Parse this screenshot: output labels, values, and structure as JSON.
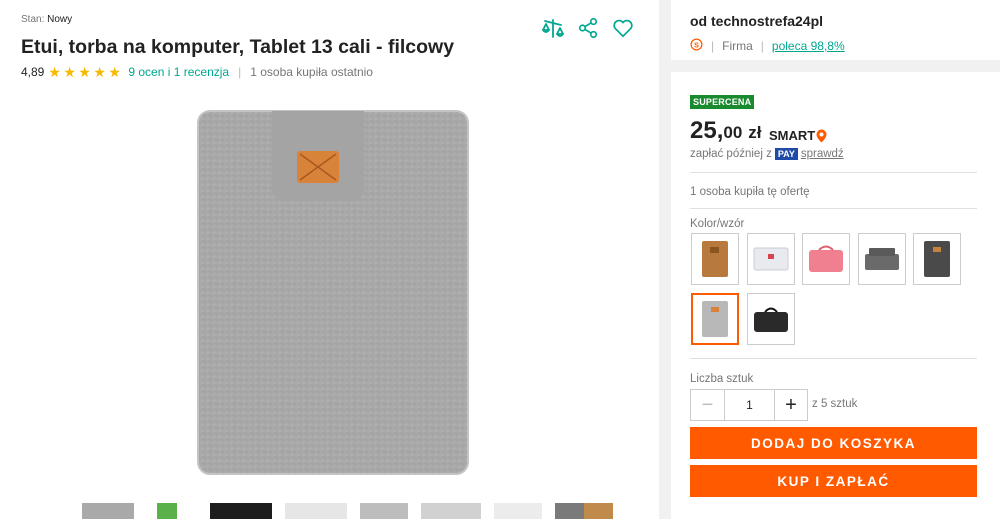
{
  "product": {
    "condition_label": "Stan:",
    "condition_value": "Nowy",
    "title": "Etui, torba na komputer, Tablet 13 cali - filcowy",
    "rating_value": "4,89",
    "stars": 5,
    "reviews_link": "9 ocen i 1 recenzja",
    "bought_recently": "1 osoba kupiła ostatnio"
  },
  "icons": {
    "compare": "compare-scales-icon",
    "share": "share-icon",
    "favorite": "heart-icon"
  },
  "seller": {
    "name": "od technostrefa24pl",
    "type": "Firma",
    "recommend": "poleca 98,8%"
  },
  "offer": {
    "badge": "SUPERCENA",
    "price_int": "25,",
    "price_frac": "00",
    "currency": "zł",
    "smart_label": "SMART",
    "paylater_prefix": "zapłać później z",
    "pay_badge": "PAY",
    "paylater_check": "sprawdź",
    "bought_offer": "1 osoba kupiła tę ofertę"
  },
  "variants": {
    "label": "Kolor/wzór",
    "items": [
      {
        "name": "brown",
        "color": "#b87a3c"
      },
      {
        "name": "white",
        "color": "#e8eaf0"
      },
      {
        "name": "pink",
        "color": "#f08090"
      },
      {
        "name": "dark-gray-bag",
        "color": "#6a6a6a"
      },
      {
        "name": "dark-gray",
        "color": "#4a4a4a"
      },
      {
        "name": "light-gray",
        "color": "#b8b8b8"
      },
      {
        "name": "black-handle",
        "color": "#2a2a2a"
      }
    ]
  },
  "quantity": {
    "label": "Liczba sztuk",
    "value": "1",
    "of": "z 5 sztuk"
  },
  "buttons": {
    "add_to_cart": "DODAJ DO KOSZYKA",
    "buy_now": "KUP I ZAPŁAĆ"
  },
  "colors": {
    "accent": "#ff5a00",
    "link": "#00a790",
    "badge_green": "#1a8a2e",
    "star": "#f9b800"
  }
}
